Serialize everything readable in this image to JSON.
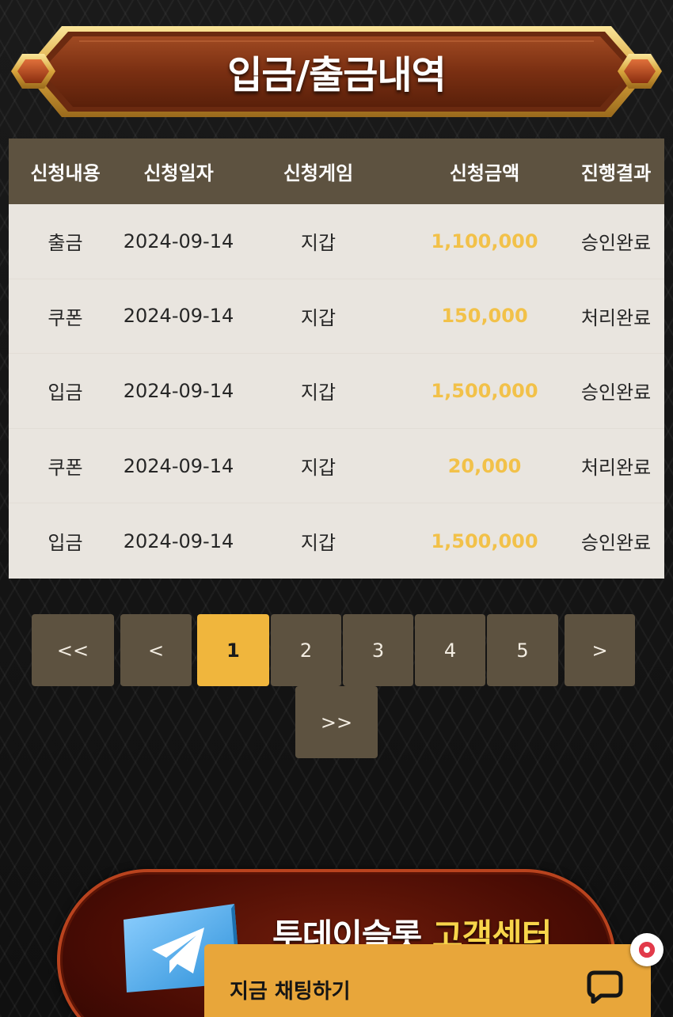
{
  "header": {
    "title": "입금/출금내역"
  },
  "table": {
    "columns": [
      "신청내용",
      "신청일자",
      "신청게임",
      "신청금액",
      "진행결과"
    ],
    "rows": [
      {
        "type": "출금",
        "date": "2024-09-14",
        "game": "지갑",
        "amount": "1,100,000",
        "status": "승인완료"
      },
      {
        "type": "쿠폰",
        "date": "2024-09-14",
        "game": "지갑",
        "amount": "150,000",
        "status": "처리완료"
      },
      {
        "type": "입금",
        "date": "2024-09-14",
        "game": "지갑",
        "amount": "1,500,000",
        "status": "승인완료"
      },
      {
        "type": "쿠폰",
        "date": "2024-09-14",
        "game": "지갑",
        "amount": "20,000",
        "status": "처리완료"
      },
      {
        "type": "입금",
        "date": "2024-09-14",
        "game": "지갑",
        "amount": "1,500,000",
        "status": "승인완료"
      }
    ]
  },
  "pagination": {
    "first": "<<",
    "prev": "<",
    "pages": [
      "1",
      "2",
      "3",
      "4",
      "5"
    ],
    "current_page": "1",
    "next": ">",
    "last": ">>"
  },
  "customer_center": {
    "brand": "투데이슬롯",
    "label": "고객센터",
    "icon": "telegram-icon"
  },
  "chat_widget": {
    "label": "지금 채팅하기",
    "icon": "chat-bubble-icon",
    "accent_color": "#e8a63a"
  },
  "colors": {
    "header_bg": "#5d5240",
    "row_bg": "#e9e5df",
    "amount_text": "#f2c149",
    "active_page": "#f0b63d"
  }
}
